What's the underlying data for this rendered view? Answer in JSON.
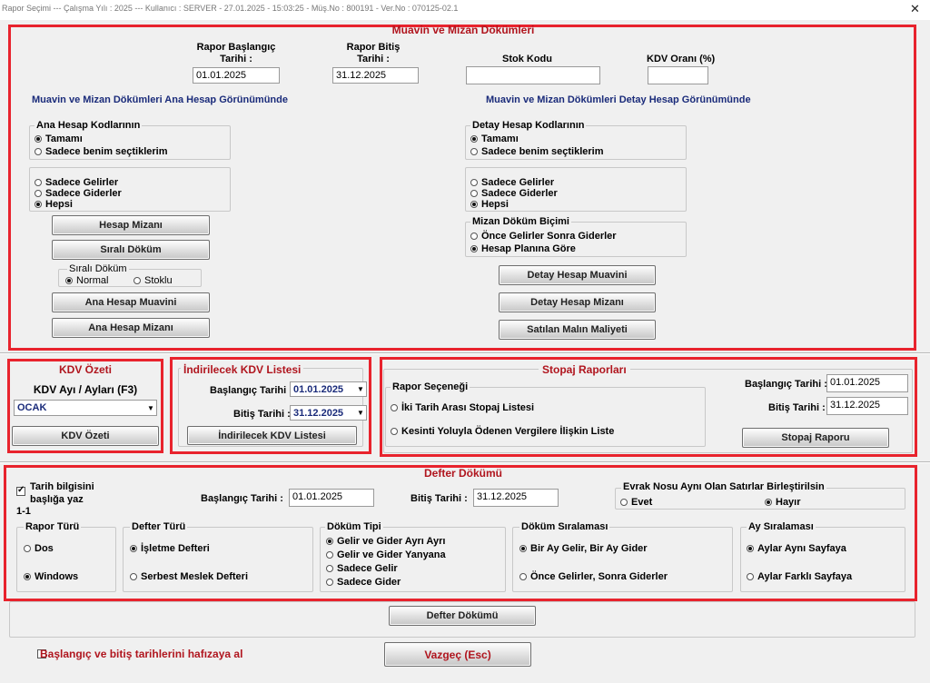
{
  "window": {
    "title": "Rapor Seçimi  ---  Çalışma Yılı : 2025  ---  Kullanıcı : SERVER - 27.01.2025 - 15:03:25 - Müş.No : 800191 - Ver.No : 070125-02.1",
    "close_label": "✕"
  },
  "muavin": {
    "title": "Muavin ve Mizan Dökümleri",
    "start_label": "Rapor Başlangıç Tarihi :",
    "start_value": "01.01.2025",
    "end_label": "Rapor Bitiş Tarihi :",
    "end_value": "31.12.2025",
    "stok_label": "Stok Kodu",
    "stok_value": "",
    "kdv_label": "KDV Oranı (%)",
    "kdv_value": "",
    "left_head": "Muavin ve Mizan Dökümleri Ana Hesap Görünümünde",
    "right_head": "Muavin ve Mizan Dökümleri Detay Hesap Görünümünde",
    "ana_group": "Ana Hesap Kodlarının",
    "ana_opts": [
      "Tamamı",
      "Sadece benim seçtiklerim"
    ],
    "ana_gg": [
      "Sadece Gelirler",
      "Sadece Giderler",
      "Hepsi"
    ],
    "btn_hesap_mizani": "Hesap Mizanı",
    "btn_sirali": "Sıralı Döküm",
    "sirali_group": "Sıralı Döküm",
    "sirali_opts": [
      "Normal",
      "Stoklu"
    ],
    "btn_ana_muavin": "Ana Hesap Muavini",
    "btn_ana_mizan": "Ana Hesap Mizanı",
    "detay_group": "Detay Hesap Kodlarının",
    "detay_opts": [
      "Tamamı",
      "Sadece benim seçtiklerim"
    ],
    "detay_gg": [
      "Sadece Gelirler",
      "Sadece Giderler",
      "Hepsi"
    ],
    "mizan_group": "Mizan Döküm Biçimi",
    "mizan_opts": [
      "Önce Gelirler Sonra Giderler",
      "Hesap Planına Göre"
    ],
    "btn_detay_muavin": "Detay Hesap Muavini",
    "btn_detay_mizan": "Detay Hesap Mizanı",
    "btn_satilan": "Satılan Malın Maliyeti"
  },
  "kdv": {
    "title": "KDV Özeti",
    "label": "KDV Ayı / Ayları (F3)",
    "month": "OCAK",
    "button": "KDV Özeti"
  },
  "indirilecek": {
    "title": "İndirilecek KDV Listesi",
    "start_label": "Başlangıç Tarihi :",
    "start_value": "01.01.2025",
    "end_label": "Bitiş Tarihi :",
    "end_value": "31.12.2025",
    "button": "İndirilecek KDV Listesi"
  },
  "stopaj": {
    "title": "Stopaj Raporları",
    "group": "Rapor Seçeneği",
    "opts": [
      "İki Tarih Arası Stopaj Listesi",
      "Kesinti Yoluyla Ödenen Vergilere İlişkin Liste"
    ],
    "start_label": "Başlangıç Tarihi :",
    "start_value": "01.01.2025",
    "end_label": "Bitiş Tarihi :",
    "end_value": "31.12.2025",
    "button": "Stopaj Raporu"
  },
  "defter": {
    "title": "Defter Dökümü",
    "tarih_check": "Tarih bilgisini başlığa yaz",
    "page_text": "1-1",
    "start_label": "Başlangıç Tarihi :",
    "start_value": "01.01.2025",
    "end_label": "Bitiş Tarihi :",
    "end_value": "31.12.2025",
    "evrak_group": "Evrak Nosu Aynı Olan Satırlar Birleştirilsin",
    "evrak_opts": [
      "Evet",
      "Hayır"
    ],
    "rapor_turu": "Rapor Türü",
    "rapor_opts": [
      "Dos",
      "Windows"
    ],
    "defter_turu": "Defter Türü",
    "defter_opts": [
      "İşletme Defteri",
      "Serbest Meslek Defteri"
    ],
    "dokum_tipi": "Döküm Tipi",
    "dokum_opts": [
      "Gelir ve Gider Ayrı Ayrı",
      "Gelir ve Gider Yanyana",
      "Sadece Gelir",
      "Sadece Gider"
    ],
    "siralama": "Döküm Sıralaması",
    "siralama_opts": [
      "Bir Ay Gelir, Bir Ay Gider",
      "Önce Gelirler, Sonra Giderler"
    ],
    "ay_siralama": "Ay Sıralaması",
    "ay_opts": [
      "Aylar Aynı Sayfaya",
      "Aylar Farklı Sayfaya"
    ],
    "button": "Defter Dökümü"
  },
  "footer": {
    "remember": "Başlangıç ve bitiş tarihlerini hafızaya al",
    "cancel": "Vazgeç (Esc)"
  },
  "colors": {
    "highlight_red": "#e8232d",
    "title_red": "#b0151e",
    "heading_blue": "#1a2b7a"
  }
}
